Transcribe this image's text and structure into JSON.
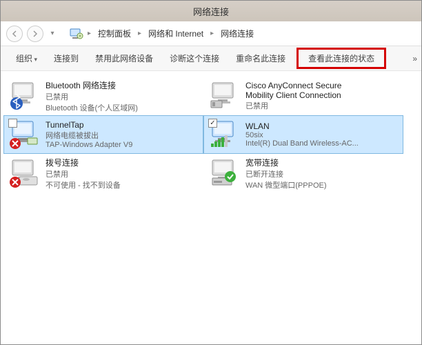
{
  "window": {
    "title": "网络连接"
  },
  "breadcrumbs": {
    "icon": "control-panel",
    "parts": [
      "控制面板",
      "网络和 Internet",
      "网络连接"
    ]
  },
  "toolbar": {
    "organize": "组织",
    "connect_to": "连接到",
    "disable_device": "禁用此网络设备",
    "diagnose": "诊断这个连接",
    "rename": "重命名此连接",
    "view_status": "查看此连接的状态",
    "more": "»"
  },
  "connections": [
    {
      "name": "Bluetooth 网络连接",
      "status": "已禁用",
      "device": "Bluetooth 设备(个人区域网)",
      "icon": "bluetooth",
      "selected": false,
      "checkbox": null
    },
    {
      "name": "Cisco AnyConnect Secure Mobility Client Connection",
      "status": "已禁用",
      "device": "",
      "icon": "vpn-disabled",
      "selected": false,
      "checkbox": null
    },
    {
      "name": "TunnelTap",
      "status": "网络电缆被拔出",
      "device": "TAP-Windows Adapter V9",
      "icon": "tap-unplugged",
      "selected": true,
      "checkbox": false
    },
    {
      "name": "WLAN",
      "status": "50six",
      "device": "Intel(R) Dual Band Wireless-AC...",
      "icon": "wlan",
      "selected": true,
      "checkbox": true
    },
    {
      "name": "拨号连接",
      "status": "已禁用",
      "device": "不可使用 - 找不到设备",
      "icon": "dialup-disabled",
      "selected": false,
      "checkbox": null
    },
    {
      "name": "宽带连接",
      "status": "已断开连接",
      "device": "WAN 微型端口(PPPOE)",
      "icon": "broadband",
      "selected": false,
      "checkbox": null
    }
  ]
}
